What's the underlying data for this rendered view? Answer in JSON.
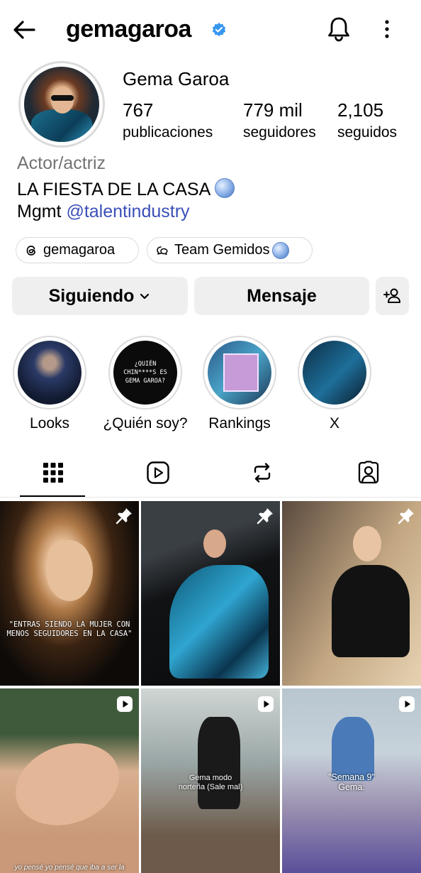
{
  "header": {
    "username": "gemagaroa",
    "verified": true,
    "icons": [
      "back-arrow-icon",
      "verified-badge-icon",
      "notification-bell-icon",
      "more-options-icon"
    ]
  },
  "profile": {
    "full_name": "Gema Garoa",
    "stats": {
      "posts_count": "767",
      "posts_label": "publicaciones",
      "followers_count": "779 mil",
      "followers_label": "seguidores",
      "following_count": "2,105",
      "following_label": "seguidos"
    },
    "category": "Actor/actriz",
    "bio_line1": "LA FIESTA DE LA CASA",
    "bio_line2_prefix": "Mgmt ",
    "bio_line2_mention": "@talentindustry",
    "threads_handle": "gemagaroa",
    "channel_name": "Team Gemidos"
  },
  "buttons": {
    "following": "Siguiendo",
    "message": "Mensaje"
  },
  "highlights": [
    {
      "label": "Looks"
    },
    {
      "label": "¿Quién soy?",
      "cover_text": "¿QUIÉN CHIN****S ES GEMA GAROA?"
    },
    {
      "label": "Rankings"
    },
    {
      "label": "X"
    }
  ],
  "tabs": [
    "posts-grid",
    "reels",
    "reposts",
    "tagged"
  ],
  "posts": [
    {
      "pinned": true,
      "type": "image",
      "overlay_text": "\"ENTRAS SIENDO LA MUJER CON MENOS SEGUIDORES EN LA CASA\""
    },
    {
      "pinned": true,
      "type": "image"
    },
    {
      "pinned": true,
      "type": "image"
    },
    {
      "pinned": false,
      "type": "reel",
      "caption": "yo pensé yo pensé que iba a ser la"
    },
    {
      "pinned": false,
      "type": "reel",
      "caption": "Gema modo norteña (Sale mal)"
    },
    {
      "pinned": false,
      "type": "reel",
      "caption": "\"Semana 9\" Gema:"
    }
  ],
  "colors": {
    "accent_blue": "#3797f0",
    "mention_blue": "#3a4fb8",
    "button_gray": "#efefef",
    "secondary_text": "#737373"
  }
}
